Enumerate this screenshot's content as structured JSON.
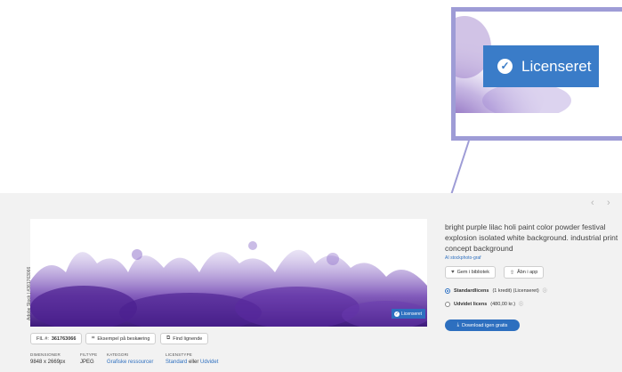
{
  "nav": {
    "prev_icon": "chevron-left-icon",
    "next_icon": "chevron-right-icon",
    "prev": "‹",
    "next": "›"
  },
  "callout": {
    "badge_label": "Licenseret",
    "badge_icon": "check-circle-icon"
  },
  "image": {
    "credit": "Adobe Stock | #361763066",
    "badge_label": "Licenseret"
  },
  "title": "bright purple lilac holi paint color powder festival explosion isolated white background. industrial print concept background",
  "author": "AI stockphoto-graf",
  "actions": {
    "save": "Gem i bibliotek",
    "open": "Åbn i app"
  },
  "licenses": [
    {
      "name": "Standardlicens",
      "detail": "(1 kredit) (Licenseret)",
      "selected": true
    },
    {
      "name": "Udvidet licens",
      "detail": "(480,00 kr.)",
      "selected": false
    }
  ],
  "download_label": "Download igen gratis",
  "file_label": "FIL #:",
  "file_id": "361763066",
  "example_button": "Eksempel på beskæring",
  "similar_button": "Find lignende",
  "meta": {
    "dimensions_label": "DIMENSIONER",
    "dimensions": "9848 x 2669px",
    "filetype_label": "FILTYPE",
    "filetype": "JPEG",
    "category_label": "KATEGORI",
    "category": "Grafiske ressourcer",
    "license_label": "LICENSTYPE",
    "license_standard": "Standard",
    "license_or": "eller",
    "license_extended": "Udvidet"
  },
  "colors": {
    "accent": "#2d6fbf",
    "callout_border": "#9e9cd6",
    "powder": "#6a3aa8"
  }
}
